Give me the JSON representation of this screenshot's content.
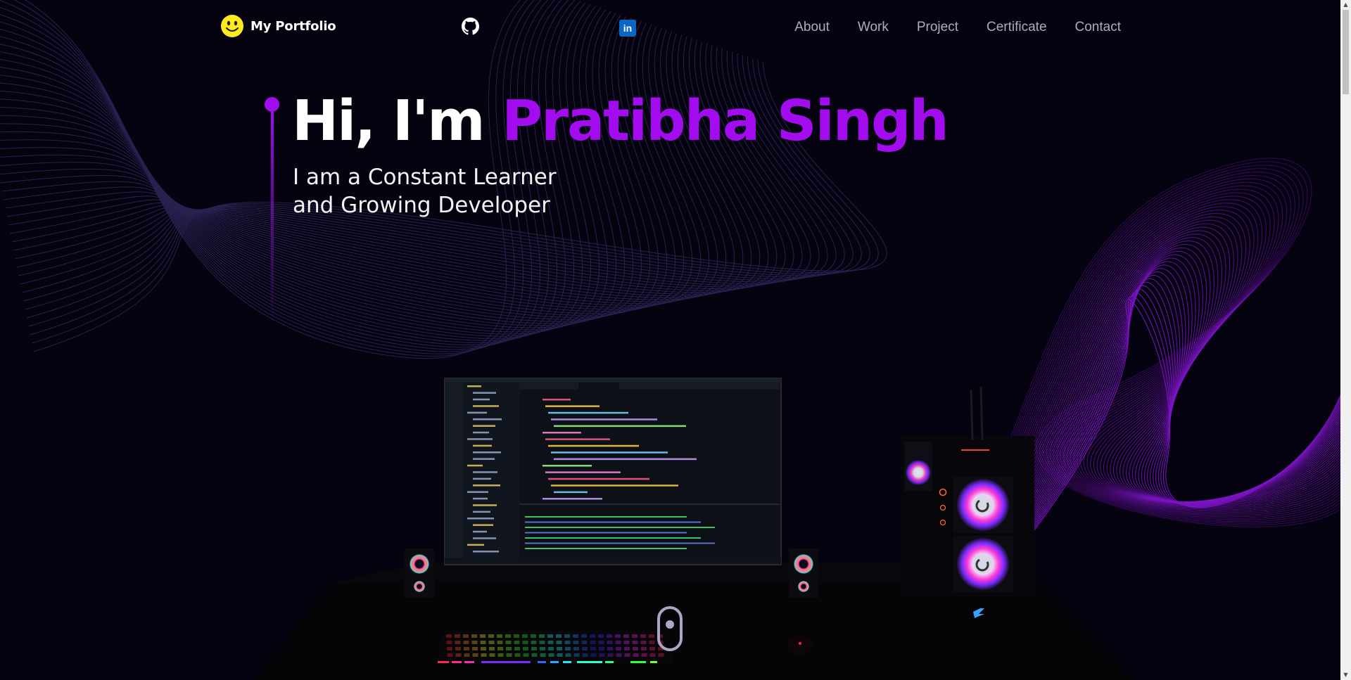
{
  "nav": {
    "brand": "My Portfolio",
    "links": [
      "About",
      "Work",
      "Project",
      "Certificate",
      "Contact"
    ],
    "icons": {
      "logo": "smiley-icon",
      "github": "github-icon",
      "linkedin": "linkedin-icon"
    },
    "linkedin_glyph": "in"
  },
  "hero": {
    "greeting": "Hi, I'm ",
    "name": "Pratibha Singh",
    "subtitle_line1": "I am a Constant Learner",
    "subtitle_line2": "and Growing Developer"
  },
  "colors": {
    "background": "#060311",
    "accent": "#a20cef",
    "nav_text": "#aeaac0",
    "linkedin": "#0a66c2",
    "logo_yellow": "#ffe91f"
  }
}
